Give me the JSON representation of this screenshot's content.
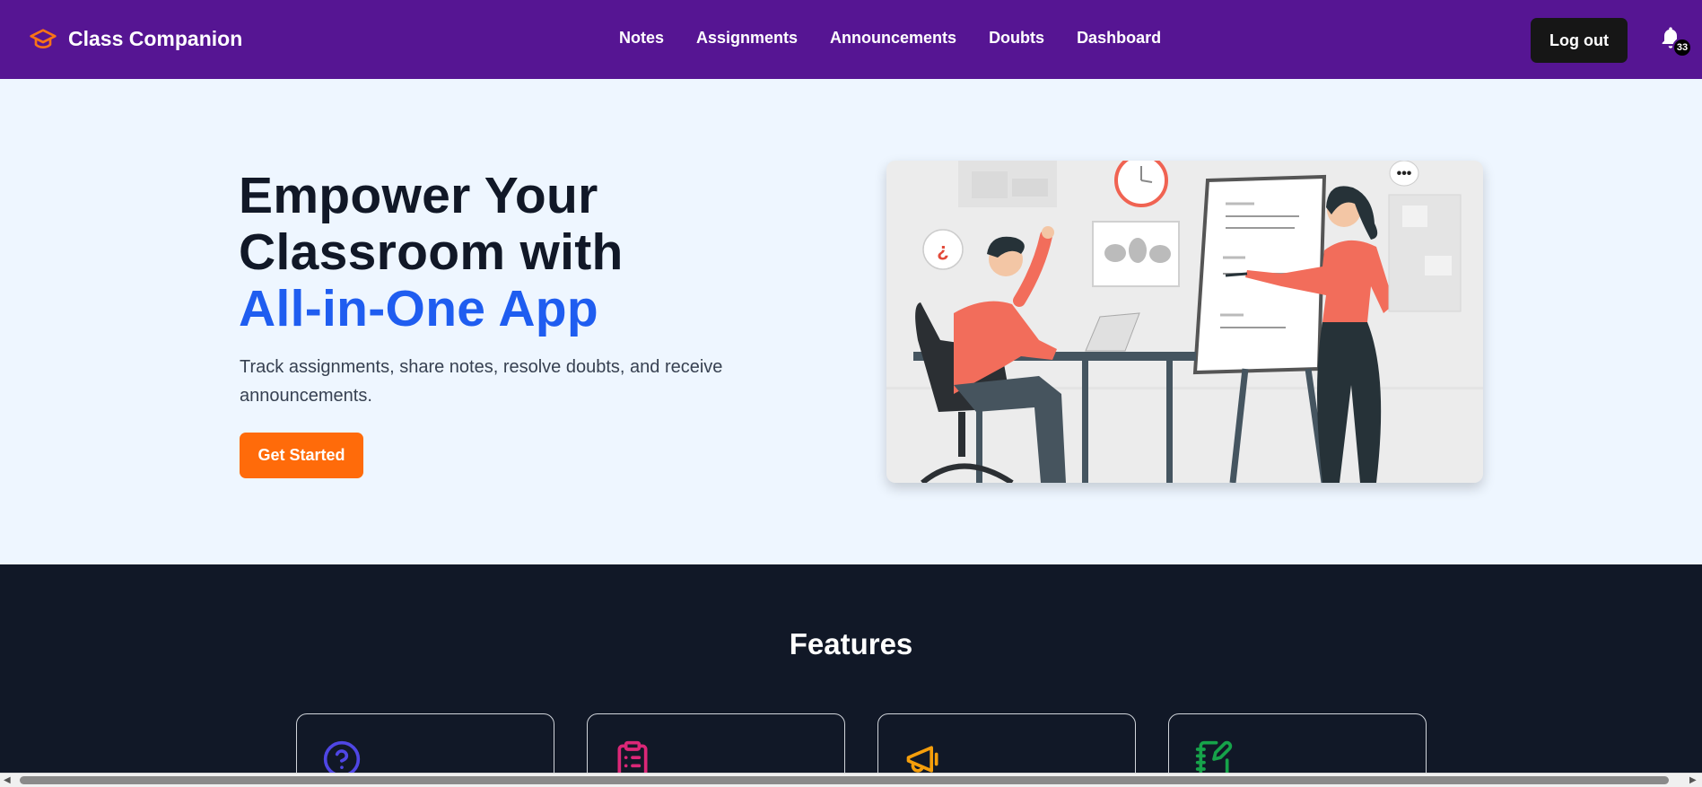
{
  "nav": {
    "brand": "Class Companion",
    "links": [
      "Notes",
      "Assignments",
      "Announcements",
      "Doubts",
      "Dashboard"
    ],
    "logout_label": "Log out",
    "notification_count": "33"
  },
  "hero": {
    "title_line1": "Empower Your",
    "title_line2": "Classroom with",
    "title_highlight": "All-in-One App",
    "subtitle": "Track assignments, share notes, resolve doubts, and receive announcements.",
    "cta_label": "Get Started",
    "illustration_question_mark": "¿"
  },
  "features": {
    "title": "Features",
    "cards": [
      {
        "icon": "question-circle-icon",
        "color": "#4f46e5"
      },
      {
        "icon": "clipboard-list-icon",
        "color": "#db2777"
      },
      {
        "icon": "megaphone-icon",
        "color": "#f59e0b"
      },
      {
        "icon": "notebook-pen-icon",
        "color": "#16a34a"
      }
    ]
  },
  "colors": {
    "nav_bg": "#561593",
    "accent_blue": "#1f5df0",
    "cta_orange": "#ff6b0a",
    "hero_bg": "#eef6ff",
    "features_bg": "#111827"
  }
}
